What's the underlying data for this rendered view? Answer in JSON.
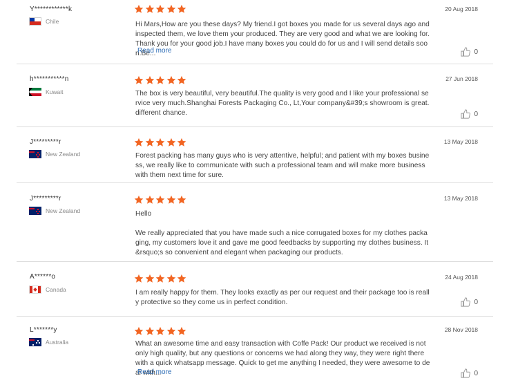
{
  "colors": {
    "star": "#f26522",
    "link": "#2b6bb5"
  },
  "reviews": [
    {
      "user": "Y************k",
      "country": "Chile",
      "flag_icon": "chile-flag-icon",
      "date": "20 Aug 2018",
      "rating": 5,
      "paragraphs": [
        "Hi Mars,How are you these days? My friend.I got boxes you made for us several days ago and inspected them, we love them your produced. They are very good and what we are looking for. Thank you for your good job.I have many boxes you could do for us and I will send details soon.Be..."
      ],
      "read_more": "Read more",
      "likes": "0"
    },
    {
      "user": "h***********n",
      "country": "Kuwait",
      "flag_icon": "kuwait-flag-icon",
      "date": "27 Jun 2018",
      "rating": 5,
      "paragraphs": [
        "The box is very beautiful, very beautiful.The quality is very good and I like your professional service very much.Shanghai Forests Packaging Co., Lt,Your company&#39;s showroom is great.different chance."
      ],
      "likes": "0"
    },
    {
      "user": "J*********r",
      "country": "New Zealand",
      "flag_icon": "new-zealand-flag-icon",
      "date": "13 May 2018",
      "rating": 5,
      "paragraphs": [
        "Forest packing has many guys who is very attentive, helpful; and patient with my boxes business, we really like to communicate with such a professional team and will make more business with them next time for sure."
      ],
      "likes": "0"
    },
    {
      "user": "J*********r",
      "country": "New Zealand",
      "flag_icon": "new-zealand-flag-icon",
      "date": "13 May 2018",
      "rating": 5,
      "paragraphs": [
        "Hello",
        "We really appreciated that you have made such a nice corrugated boxes for my clothes packaging, my customers love it and gave me good feedbacks by supporting my clothes business. It&rsquo;s so convenient and elegant when packaging our products."
      ]
    },
    {
      "user": "A******o",
      "country": "Canada",
      "flag_icon": "canada-flag-icon",
      "date": "24 Aug 2018",
      "rating": 5,
      "paragraphs": [
        "I am really happy for them.  They looks exactly as per our request and their package too is really protective so they come us in perfect condition."
      ],
      "likes": "0"
    },
    {
      "user": "L*******y",
      "country": "Australia",
      "flag_icon": "australia-flag-icon",
      "date": "28 Nov 2018",
      "rating": 5,
      "paragraphs": [
        "What an awesome time and easy transaction with Coffe Pack! Our product we received is not only high quality, but any questions or concerns we had along they way, they were right there with a quick whatsapp message. Quick to get me anything I needed, they were awesome to deal with..."
      ],
      "read_more": "Read more",
      "likes": "0"
    }
  ]
}
